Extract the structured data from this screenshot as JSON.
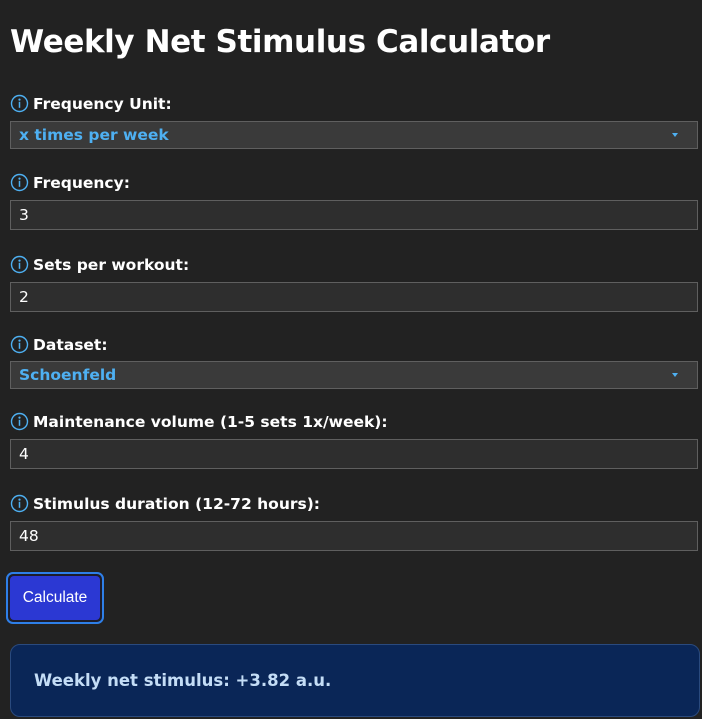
{
  "page": {
    "title": "Weekly Net Stimulus Calculator"
  },
  "icons": {
    "info": "info-circle-icon",
    "dropdown": "caret-down-icon"
  },
  "colors": {
    "background": "#222222",
    "accent_text": "#4eb0f2",
    "button": "#2b38d3",
    "button_focus_ring": "#2e7fe8",
    "result_background": "#0a2657",
    "result_text": "#c4ddf6"
  },
  "form": {
    "frequency_unit": {
      "label": "Frequency Unit:",
      "selected": "x times per week"
    },
    "frequency": {
      "label": "Frequency:",
      "value": "3"
    },
    "sets_per_workout": {
      "label": "Sets per workout:",
      "value": "2"
    },
    "dataset": {
      "label": "Dataset:",
      "selected": "Schoenfeld"
    },
    "maintenance_volume": {
      "label": "Maintenance volume (1-5 sets 1x/week):",
      "value": "4"
    },
    "stimulus_duration": {
      "label": "Stimulus duration (12-72 hours):",
      "value": "48"
    },
    "calculate_label": "Calculate"
  },
  "result": {
    "text": "Weekly net stimulus: +3.82 a.u."
  }
}
